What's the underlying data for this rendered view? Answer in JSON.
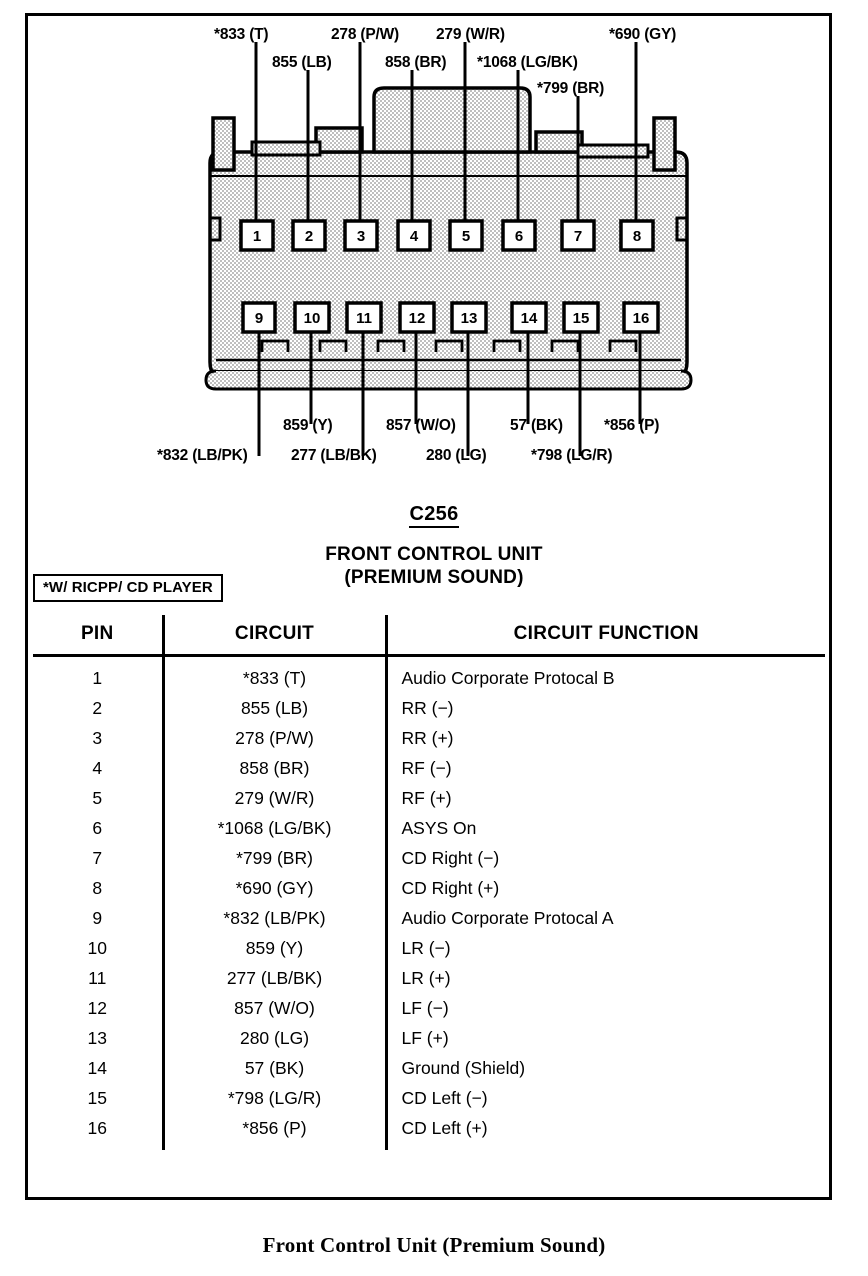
{
  "connector": {
    "id": "C256",
    "title_line1": "FRONT CONTROL UNIT",
    "title_line2": "(PREMIUM SOUND)",
    "legend_note": "*W/ RICPP/ CD PLAYER"
  },
  "caption": "Front Control Unit (Premium Sound)",
  "top_labels": [
    {
      "text": "*833 (T)",
      "pin": 1
    },
    {
      "text": "855 (LB)",
      "pin": 2
    },
    {
      "text": "278 (P/W)",
      "pin": 3
    },
    {
      "text": "858 (BR)",
      "pin": 4
    },
    {
      "text": "279 (W/R)",
      "pin": 5
    },
    {
      "text": "*1068 (LG/BK)",
      "pin": 6
    },
    {
      "text": "*799 (BR)",
      "pin": 7
    },
    {
      "text": "*690 (GY)",
      "pin": 8
    }
  ],
  "bottom_labels": [
    {
      "text": "*832 (LB/PK)",
      "pin": 9
    },
    {
      "text": "859 (Y)",
      "pin": 10
    },
    {
      "text": "277 (LB/BK)",
      "pin": 11
    },
    {
      "text": "857 (W/O)",
      "pin": 12
    },
    {
      "text": "280 (LG)",
      "pin": 13
    },
    {
      "text": "57 (BK)",
      "pin": 14
    },
    {
      "text": "*798 (LG/R)",
      "pin": 15
    },
    {
      "text": "*856 (P)",
      "pin": 16
    }
  ],
  "pin_numbers_top": [
    "1",
    "2",
    "3",
    "4",
    "5",
    "6",
    "7",
    "8"
  ],
  "pin_numbers_bottom": [
    "9",
    "10",
    "11",
    "12",
    "13",
    "14",
    "15",
    "16"
  ],
  "table": {
    "headers": [
      "PIN",
      "CIRCUIT",
      "CIRCUIT FUNCTION"
    ],
    "rows": [
      {
        "pin": "1",
        "circuit": "*833 (T)",
        "function": "Audio Corporate Protocal B"
      },
      {
        "pin": "2",
        "circuit": "855 (LB)",
        "function": "RR (−)"
      },
      {
        "pin": "3",
        "circuit": "278 (P/W)",
        "function": "RR (+)"
      },
      {
        "pin": "4",
        "circuit": "858 (BR)",
        "function": "RF (−)"
      },
      {
        "pin": "5",
        "circuit": "279 (W/R)",
        "function": "RF (+)"
      },
      {
        "pin": "6",
        "circuit": "*1068 (LG/BK)",
        "function": "ASYS On"
      },
      {
        "pin": "7",
        "circuit": "*799 (BR)",
        "function": "CD Right (−)"
      },
      {
        "pin": "8",
        "circuit": "*690 (GY)",
        "function": "CD Right (+)"
      },
      {
        "pin": "9",
        "circuit": "*832 (LB/PK)",
        "function": "Audio Corporate Protocal A"
      },
      {
        "pin": "10",
        "circuit": "859 (Y)",
        "function": "LR (−)"
      },
      {
        "pin": "11",
        "circuit": "277 (LB/BK)",
        "function": "LR (+)"
      },
      {
        "pin": "12",
        "circuit": "857 (W/O)",
        "function": "LF (−)"
      },
      {
        "pin": "13",
        "circuit": "280 (LG)",
        "function": "LF (+)"
      },
      {
        "pin": "14",
        "circuit": "57 (BK)",
        "function": "Ground (Shield)"
      },
      {
        "pin": "15",
        "circuit": "*798 (LG/R)",
        "function": "CD Left (−)"
      },
      {
        "pin": "16",
        "circuit": "*856 (P)",
        "function": "CD Left (+)"
      }
    ]
  },
  "colors": {
    "line": "#000000",
    "body_fill": "#d9d9d9",
    "page": "#ffffff"
  }
}
